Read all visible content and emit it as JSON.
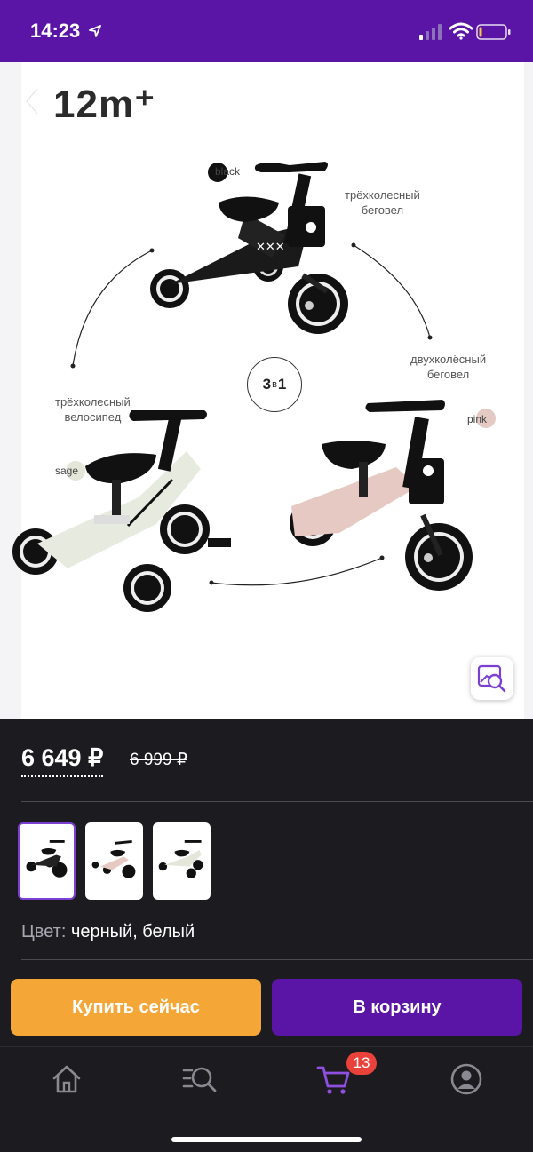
{
  "status_bar": {
    "time": "14:23"
  },
  "header": {
    "age_label": "12m⁺"
  },
  "product_image": {
    "captions": {
      "top_right": "трёхколесный\nбеговел",
      "right": "двухколёсный\nбеговел",
      "left": "трёхколесный\nвелосипед"
    },
    "swatches": {
      "black": "black",
      "pink": "pink",
      "sage": "sage"
    },
    "center_badge": {
      "left": "3",
      "mid": "в",
      "right": "1"
    }
  },
  "price": {
    "current": "6 649 ₽",
    "old": "6 999 ₽"
  },
  "color": {
    "label": "Цвет:",
    "value": "черный, белый"
  },
  "title_peek": "...",
  "buttons": {
    "buy_now": "Купить сейчас",
    "add_to_cart": "В корзину"
  },
  "tabbar": {
    "cart_count": "13"
  },
  "colors": {
    "brand_purple": "#5a14a6",
    "buy_orange": "#f4a636",
    "badge_red": "#e8423b"
  }
}
